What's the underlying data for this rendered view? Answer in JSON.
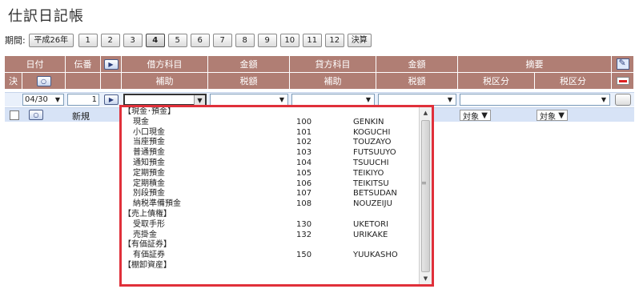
{
  "title": "仕訳日記帳",
  "period": {
    "label": "期間:",
    "year": "平成26年",
    "months": [
      "1",
      "2",
      "3",
      "4",
      "5",
      "6",
      "7",
      "8",
      "9",
      "10",
      "11",
      "12"
    ],
    "active_month": "4",
    "settlement": "決算"
  },
  "header": {
    "row1": {
      "date": "日付",
      "slip_no": "伝番",
      "debit_account": "借方科目",
      "amount": "金額",
      "credit_account": "貸方科目",
      "amount2": "金額",
      "description": "摘要"
    },
    "row2": {
      "decision": "決",
      "sub_account": "補助",
      "tax_amount": "税額",
      "sub_account2": "補助",
      "tax_amount2": "税額",
      "tax_class": "税区分",
      "tax_class2": "税区分"
    }
  },
  "entry_row": {
    "date": "04/30",
    "slip_no": "1"
  },
  "new_row": {
    "label": "新規",
    "tax_target": "対象",
    "tax_target2": "対象"
  },
  "dropdown": {
    "items": [
      {
        "type": "group",
        "name": "【現金･預金】"
      },
      {
        "type": "item",
        "name": "現金",
        "code": "100",
        "kana": "GENKIN"
      },
      {
        "type": "item",
        "name": "小口現金",
        "code": "101",
        "kana": "KOGUCHI"
      },
      {
        "type": "item",
        "name": "当座預金",
        "code": "102",
        "kana": "TOUZAYO"
      },
      {
        "type": "item",
        "name": "普通預金",
        "code": "103",
        "kana": "FUTSUUYO"
      },
      {
        "type": "item",
        "name": "通知預金",
        "code": "104",
        "kana": "TSUUCHI"
      },
      {
        "type": "item",
        "name": "定期預金",
        "code": "105",
        "kana": "TEIKIYO"
      },
      {
        "type": "item",
        "name": "定期積金",
        "code": "106",
        "kana": "TEIKITSU"
      },
      {
        "type": "item",
        "name": "別段預金",
        "code": "107",
        "kana": "BETSUDAN"
      },
      {
        "type": "item",
        "name": "納税準備預金",
        "code": "108",
        "kana": "NOUZEIJU"
      },
      {
        "type": "group",
        "name": "【売上債権】"
      },
      {
        "type": "item",
        "name": "受取手形",
        "code": "130",
        "kana": "UKETORI"
      },
      {
        "type": "item",
        "name": "売掛金",
        "code": "132",
        "kana": "URIKAKE"
      },
      {
        "type": "group",
        "name": "【有価証券】"
      },
      {
        "type": "item",
        "name": "有価証券",
        "code": "150",
        "kana": "YUUKASHO"
      },
      {
        "type": "group",
        "name": "【棚卸資産】"
      }
    ]
  }
}
